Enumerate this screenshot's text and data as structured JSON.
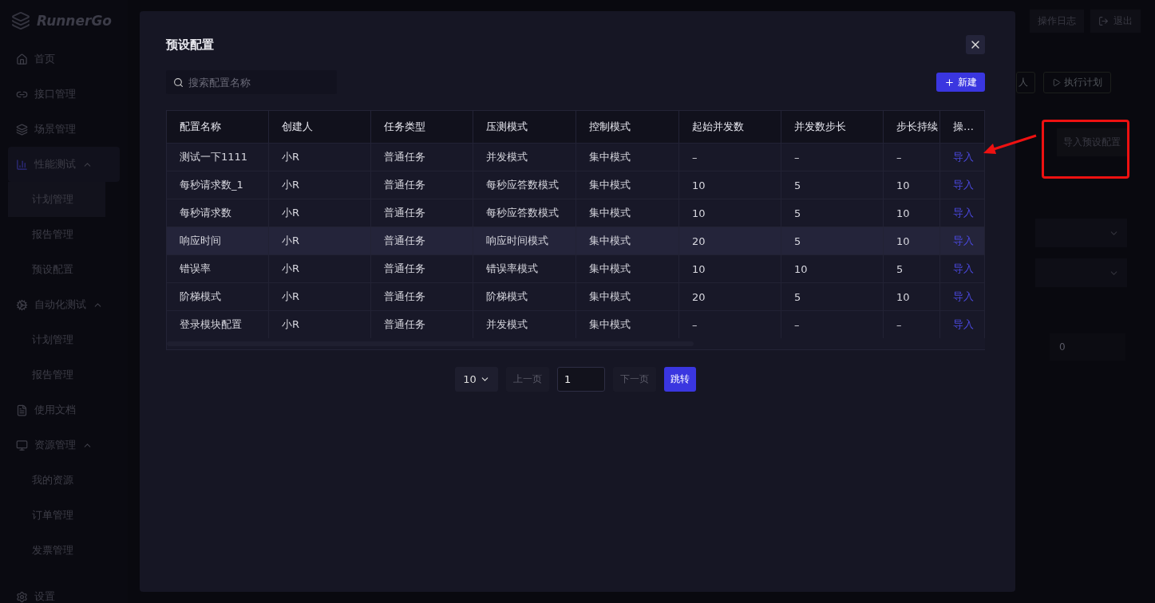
{
  "app": {
    "logo": "RunnerGo"
  },
  "sidebar": {
    "items": [
      {
        "label": "首页",
        "selected": false
      },
      {
        "label": "接口管理",
        "selected": false
      },
      {
        "label": "场景管理",
        "selected": false
      },
      {
        "label": "性能测试",
        "expanded": true,
        "selected": true,
        "children": [
          {
            "label": "计划管理",
            "selected": true
          },
          {
            "label": "报告管理",
            "selected": false
          },
          {
            "label": "预设配置",
            "selected": false
          }
        ]
      },
      {
        "label": "自动化测试",
        "expanded": true,
        "selected": false,
        "children": [
          {
            "label": "计划管理",
            "selected": false
          },
          {
            "label": "报告管理",
            "selected": false
          }
        ]
      },
      {
        "label": "使用文档",
        "selected": false
      },
      {
        "label": "资源管理",
        "expanded": true,
        "selected": false,
        "children": [
          {
            "label": "我的资源",
            "selected": false
          },
          {
            "label": "订单管理",
            "selected": false
          },
          {
            "label": "发票管理",
            "selected": false
          }
        ]
      },
      {
        "label": "设置",
        "selected": false
      }
    ]
  },
  "topbar": {
    "buttons": [
      "操作日志",
      "退出"
    ]
  },
  "background_panel": {
    "buttons": [
      "人",
      "执行计划"
    ],
    "import_button": "导入预设配置",
    "field_value": "0"
  },
  "modal": {
    "title": "预设配置",
    "search": {
      "placeholder": "搜索配置名称"
    },
    "new_button": "新建",
    "table": {
      "columns": [
        "配置名称",
        "创建人",
        "任务类型",
        "压测模式",
        "控制模式",
        "起始并发数",
        "并发数步长",
        "步长持续",
        "操…"
      ],
      "rows": [
        {
          "cells": [
            "测试一下1111",
            "小R",
            "普通任务",
            "并发模式",
            "集中模式",
            "–",
            "–",
            "–"
          ],
          "action": "导入",
          "hovered": false
        },
        {
          "cells": [
            "每秒请求数_1",
            "小R",
            "普通任务",
            "每秒应答数模式",
            "集中模式",
            "10",
            "5",
            "10"
          ],
          "action": "导入",
          "hovered": false
        },
        {
          "cells": [
            "每秒请求数",
            "小R",
            "普通任务",
            "每秒应答数模式",
            "集中模式",
            "10",
            "5",
            "10"
          ],
          "action": "导入",
          "hovered": false
        },
        {
          "cells": [
            "响应时间",
            "小R",
            "普通任务",
            "响应时间模式",
            "集中模式",
            "20",
            "5",
            "10"
          ],
          "action": "导入",
          "hovered": true
        },
        {
          "cells": [
            "错误率",
            "小R",
            "普通任务",
            "错误率模式",
            "集中模式",
            "10",
            "10",
            "5"
          ],
          "action": "导入",
          "hovered": false
        },
        {
          "cells": [
            "阶梯模式",
            "小R",
            "普通任务",
            "阶梯模式",
            "集中模式",
            "20",
            "5",
            "10"
          ],
          "action": "导入",
          "hovered": false
        },
        {
          "cells": [
            "登录模块配置",
            "小R",
            "普通任务",
            "并发模式",
            "集中模式",
            "–",
            "–",
            "–"
          ],
          "action": "导入",
          "hovered": false
        }
      ]
    },
    "pagination": {
      "page_size": "10",
      "prev": "上一页",
      "prev_disabled": true,
      "page": "1",
      "next": "下一页",
      "next_disabled": true,
      "jump": "跳转"
    }
  }
}
